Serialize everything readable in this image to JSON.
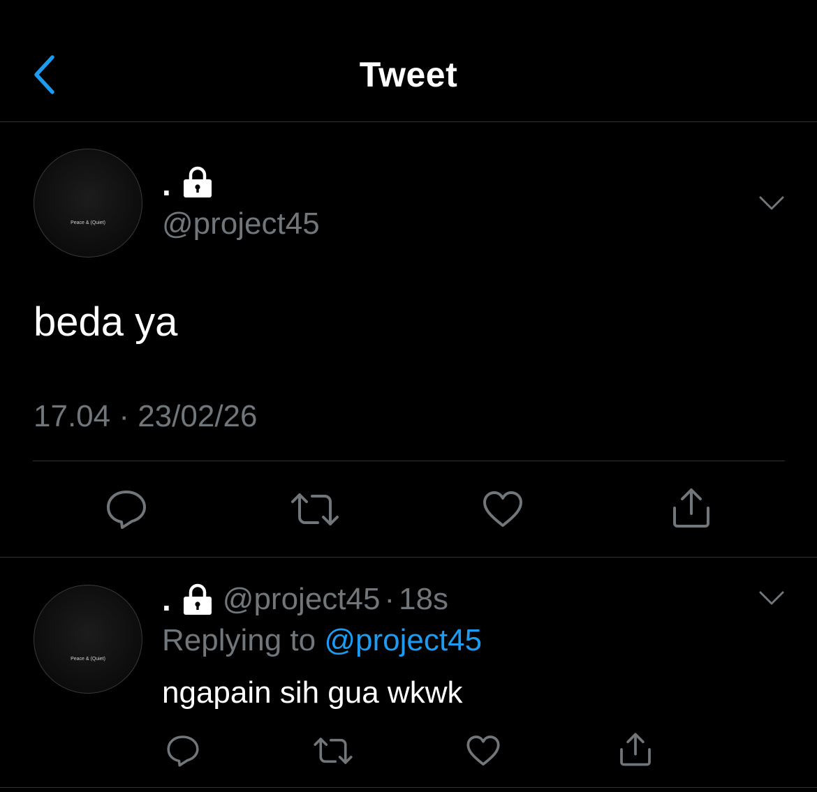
{
  "header": {
    "title": "Tweet",
    "back_icon": "chevron-left-icon"
  },
  "colors": {
    "background": "#000000",
    "text_primary": "#ffffff",
    "text_secondary": "#71767b",
    "accent": "#1d9bf0",
    "divider": "#2f3336"
  },
  "tweet": {
    "avatar_text": "Peace & (Quiet)",
    "display_name": ".",
    "handle": "@project45",
    "text": "beda ya",
    "timestamp": "17.04 · 23/02/26",
    "actions": [
      "reply-icon",
      "retweet-icon",
      "like-icon",
      "share-icon"
    ]
  },
  "reply": {
    "avatar_text": "Peace & (Quiet)",
    "display_name": ".",
    "handle": "@project45",
    "separator": "·",
    "time": "18s",
    "replying_prefix": "Replying to",
    "replying_to": "@project45",
    "text": "ngapain sih gua wkwk",
    "actions": [
      "reply-icon",
      "retweet-icon",
      "like-icon",
      "share-icon"
    ]
  }
}
